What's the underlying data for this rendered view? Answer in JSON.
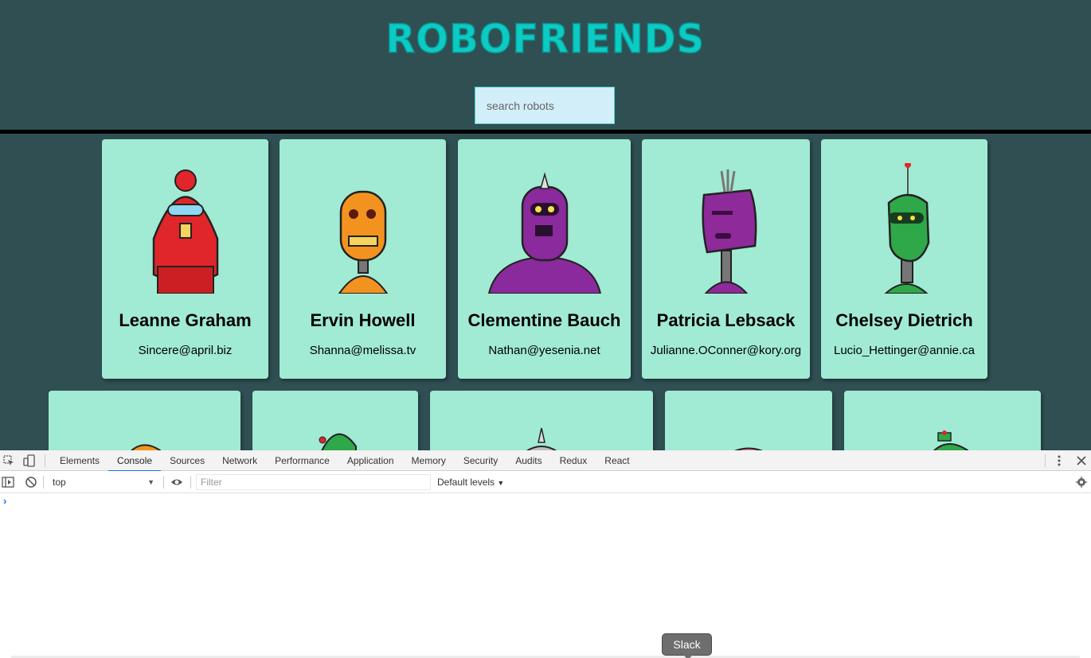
{
  "app": {
    "title": "ROBOFRIENDS",
    "search_placeholder": "search robots"
  },
  "robots": [
    {
      "name": "Leanne Graham",
      "email": "Sincere@april.biz",
      "color": "#e0262a"
    },
    {
      "name": "Ervin Howell",
      "email": "Shanna@melissa.tv",
      "color": "#f3931f"
    },
    {
      "name": "Clementine Bauch",
      "email": "Nathan@yesenia.net",
      "color": "#8a2a9c"
    },
    {
      "name": "Patricia Lebsack",
      "email": "Julianne.OConner@kory.org",
      "color": "#8e2a9a"
    },
    {
      "name": "Chelsey Dietrich",
      "email": "Lucio_Hettinger@annie.ca",
      "color": "#2fa84a"
    }
  ],
  "robots_row2_colors": [
    "#f3931f",
    "#2fa84a",
    "#9c9c9c",
    "#ef7fb6",
    "#2fa84a"
  ],
  "devtools": {
    "tabs": [
      "Elements",
      "Console",
      "Sources",
      "Network",
      "Performance",
      "Application",
      "Memory",
      "Security",
      "Audits",
      "Redux",
      "React"
    ],
    "active_tab": "Console",
    "context": "top",
    "filter_placeholder": "Filter",
    "levels": "Default levels",
    "prompt": "›"
  },
  "tooltip": {
    "label": "Slack"
  }
}
